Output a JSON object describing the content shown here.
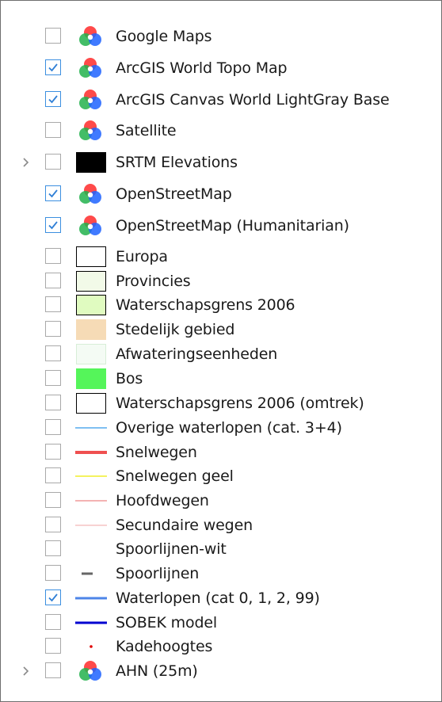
{
  "layers": [
    {
      "label": "Google Maps",
      "checked": false,
      "expandable": false,
      "symbol": "colorwheel-icon"
    },
    {
      "label": "ArcGIS World Topo Map",
      "checked": true,
      "expandable": false,
      "symbol": "colorwheel-icon"
    },
    {
      "label": "ArcGIS Canvas World LightGray Base",
      "checked": true,
      "expandable": false,
      "symbol": "colorwheel-icon"
    },
    {
      "label": "Satellite",
      "checked": false,
      "expandable": false,
      "symbol": "colorwheel-icon"
    },
    {
      "label": "SRTM Elevations",
      "checked": false,
      "expandable": true,
      "symbol": "black-box-swatch"
    },
    {
      "label": "OpenStreetMap",
      "checked": true,
      "expandable": false,
      "symbol": "colorwheel-icon"
    },
    {
      "label": "OpenStreetMap (Humanitarian)",
      "checked": true,
      "expandable": false,
      "symbol": "colorwheel-icon"
    },
    {
      "label": "Europa",
      "checked": false,
      "expandable": false,
      "symbol": "polygon-swatch",
      "fill": "#ffffff",
      "stroke": "#000000"
    },
    {
      "label": "Provincies",
      "checked": false,
      "expandable": false,
      "symbol": "polygon-swatch",
      "fill": "#f2fae8",
      "stroke": "#000000"
    },
    {
      "label": "Waterschapsgrens 2006",
      "checked": false,
      "expandable": false,
      "symbol": "polygon-swatch",
      "fill": "#e0fbc0",
      "stroke": "#000000"
    },
    {
      "label": "Stedelijk gebied",
      "checked": false,
      "expandable": false,
      "symbol": "polygon-swatch",
      "fill": "#f6dbb6",
      "stroke": "#f6dbb6"
    },
    {
      "label": "Afwateringseenheden",
      "checked": false,
      "expandable": false,
      "symbol": "polygon-swatch",
      "fill": "#f4fbf4",
      "stroke": "#d7eed7"
    },
    {
      "label": "Bos",
      "checked": false,
      "expandable": false,
      "symbol": "polygon-swatch",
      "fill": "#55f55a",
      "stroke": "#55f55a"
    },
    {
      "label": "Waterschapsgrens 2006 (omtrek)",
      "checked": false,
      "expandable": false,
      "symbol": "polygon-swatch",
      "fill": "#ffffff",
      "stroke": "#000000"
    },
    {
      "label": "Overige waterlopen (cat. 3+4)",
      "checked": false,
      "expandable": false,
      "symbol": "line-swatch",
      "stroke": "#55aaee",
      "weight": "thin"
    },
    {
      "label": "Snelwegen",
      "checked": false,
      "expandable": false,
      "symbol": "line-swatch",
      "stroke": "#ef5050",
      "weight": "thick"
    },
    {
      "label": "Snelwegen geel",
      "checked": false,
      "expandable": false,
      "symbol": "line-swatch",
      "stroke": "#f1ee2a",
      "weight": "thin"
    },
    {
      "label": "Hoofdwegen",
      "checked": false,
      "expandable": false,
      "symbol": "line-swatch",
      "stroke": "#f19a9a",
      "weight": "thin"
    },
    {
      "label": "Secundaire wegen",
      "checked": false,
      "expandable": false,
      "symbol": "line-swatch",
      "stroke": "#f6c4c4",
      "weight": "thin"
    },
    {
      "label": "Spoorlijnen-wit",
      "checked": false,
      "expandable": false,
      "symbol": "none"
    },
    {
      "label": "Spoorlijnen",
      "checked": false,
      "expandable": false,
      "symbol": "line-swatch",
      "stroke": "#666666",
      "weight": "short"
    },
    {
      "label": "Waterlopen (cat 0, 1, 2, 99)",
      "checked": true,
      "expandable": false,
      "symbol": "line-swatch",
      "stroke": "#4d85e8",
      "weight": "medium"
    },
    {
      "label": "SOBEK model",
      "checked": false,
      "expandable": false,
      "symbol": "line-swatch",
      "stroke": "#0000d0",
      "weight": "medium"
    },
    {
      "label": "Kadehoogtes",
      "checked": false,
      "expandable": false,
      "symbol": "point-swatch",
      "fill": "#e00000"
    },
    {
      "label": "AHN (25m)",
      "checked": false,
      "expandable": true,
      "symbol": "colorwheel-icon"
    }
  ]
}
